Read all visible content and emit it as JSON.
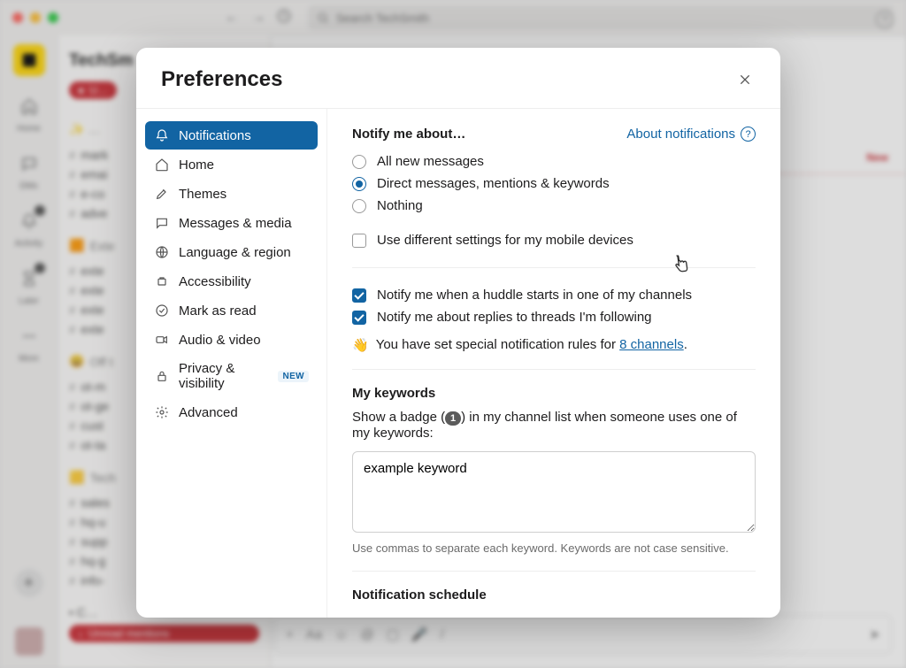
{
  "background": {
    "search_placeholder": "Search TechSmith",
    "workspace_title": "TechSm",
    "rail": {
      "home": "Home",
      "dms": "DMs",
      "activity": "Activity",
      "later": "Later",
      "more": "More"
    },
    "sections": {
      "channels_prefix": "#",
      "ch1": "mark",
      "ch2": "emai",
      "ch3": "e-co",
      "ch4": "adve",
      "ext_label": "Exte",
      "ext1": "exte",
      "ext2": "exte",
      "ext3": "exte",
      "ext4": "exte",
      "off_label": "Off t",
      "off1": "ot-m",
      "off2": "ot-ge",
      "off3": "cust",
      "off4": "ot-ta",
      "tech_label": "Tech",
      "t1": "sales",
      "t2": "hq-u",
      "t3": "supp",
      "t4": "hq-g",
      "t5": "info-"
    },
    "unread_label": "Unread mentions",
    "new_label": "New"
  },
  "modal": {
    "title": "Preferences",
    "sidebar": {
      "notifications": "Notifications",
      "home": "Home",
      "themes": "Themes",
      "messages_media": "Messages & media",
      "language_region": "Language & region",
      "accessibility": "Accessibility",
      "mark_as_read": "Mark as read",
      "audio_video": "Audio & video",
      "privacy_visibility": "Privacy & visibility",
      "new_badge": "NEW",
      "advanced": "Advanced"
    },
    "content": {
      "notify_heading": "Notify me about…",
      "about_link": "About notifications",
      "opt_all": "All new messages",
      "opt_direct": "Direct messages, mentions & keywords",
      "opt_nothing": "Nothing",
      "mobile_diff": "Use different settings for my mobile devices",
      "huddle_check": "Notify me when a huddle starts in one of my channels",
      "threads_check": "Notify me about replies to threads I'm following",
      "wave_emoji": "👋",
      "special_rules_pre": "You have set special notification rules for ",
      "special_rules_link": "8 channels",
      "special_rules_post": ".",
      "keywords_heading": "My keywords",
      "keywords_desc_pre": "Show a badge (",
      "keywords_badge": "1",
      "keywords_desc_post": ") in my channel list when someone uses one of my keywords:",
      "keywords_value": "example keyword",
      "keywords_hint": "Use commas to separate each keyword. Keywords are not case sensitive.",
      "schedule_heading": "Notification schedule"
    }
  }
}
